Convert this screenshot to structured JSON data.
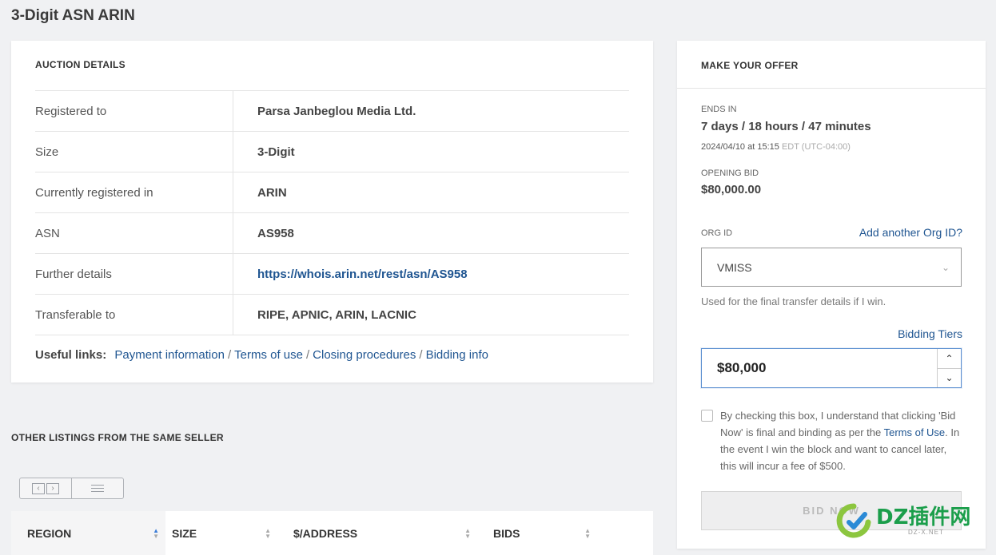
{
  "page": {
    "title": "3-Digit ASN ARIN"
  },
  "auction_details": {
    "heading": "AUCTION DETAILS",
    "rows": [
      {
        "label": "Registered to",
        "value": "Parsa Janbeglou Media Ltd."
      },
      {
        "label": "Size",
        "value": "3-Digit"
      },
      {
        "label": "Currently registered in",
        "value": "ARIN"
      },
      {
        "label": "ASN",
        "value": "AS958"
      },
      {
        "label": "Further details",
        "value": "https://whois.arin.net/rest/asn/AS958"
      },
      {
        "label": "Transferable to",
        "value": "RIPE, APNIC, ARIN, LACNIC"
      }
    ],
    "useful_links": {
      "label": "Useful links:",
      "links": [
        "Payment information",
        "Terms of use",
        "Closing procedures",
        "Bidding info"
      ],
      "separator": "/"
    }
  },
  "other_listings": {
    "heading": "OTHER LISTINGS FROM THE SAME SELLER",
    "columns": [
      "REGION",
      "SIZE",
      "$/ADDRESS",
      "BIDS"
    ]
  },
  "offer": {
    "heading": "MAKE YOUR OFFER",
    "ends_in_label": "ENDS IN",
    "ends_in_value": "7 days / 18 hours / 47 minutes",
    "ends_date": "2024/04/10 at 15:15",
    "ends_tz": "EDT (UTC-04:00)",
    "opening_bid_label": "OPENING BID",
    "opening_bid_value": "$80,000.00",
    "org_id_label": "ORG ID",
    "add_org_link": "Add another Org ID?",
    "org_id_selected": "VMISS",
    "org_help": "Used for the final transfer details if I win.",
    "bidding_tiers_link": "Bidding Tiers",
    "bid_amount": "$80,000",
    "consent_text_before": "By checking this box, I understand that clicking 'Bid Now' is final and binding as per the ",
    "consent_link": "Terms of Use",
    "consent_text_after": ". In the event I win the block and want to cancel later, this will incur a fee of $500.",
    "bid_button": "BID NOW"
  },
  "watermark": {
    "main": "DZ插件网",
    "sub": "DZ-X.NET"
  },
  "colors": {
    "link": "#1f5591",
    "accent": "#3b7dd8",
    "watermark": "#1b9e4b"
  }
}
